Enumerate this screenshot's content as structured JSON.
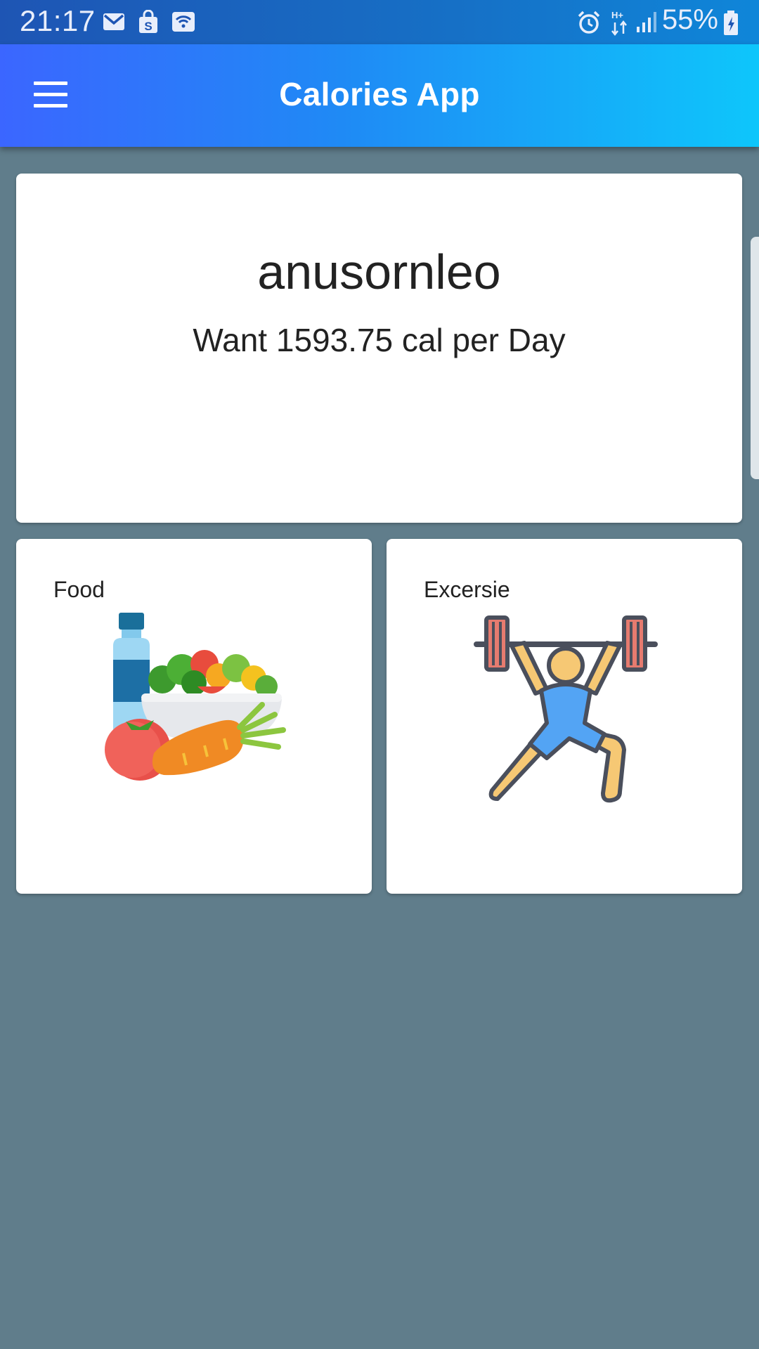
{
  "status_bar": {
    "time": "21:17",
    "battery": "55%",
    "icons": [
      "gmail-icon",
      "shopping-icon",
      "wifi-icon",
      "alarm-icon",
      "data-arrows-icon",
      "signal-icon",
      "battery-charging-icon"
    ]
  },
  "app_bar": {
    "title": "Calories App",
    "menu_icon": "hamburger-menu-icon"
  },
  "profile": {
    "username": "anusornleo",
    "goal_text": "Want 1593.75 cal per Day"
  },
  "cards": {
    "food": {
      "label": "Food",
      "icon": "food-groceries-icon"
    },
    "exercise": {
      "label": "Excersie",
      "icon": "weightlifter-icon"
    }
  },
  "colors": {
    "background": "#607d8b",
    "app_bar_start": "#3b66ff",
    "app_bar_end": "#0ec6fb",
    "card": "#ffffff"
  }
}
